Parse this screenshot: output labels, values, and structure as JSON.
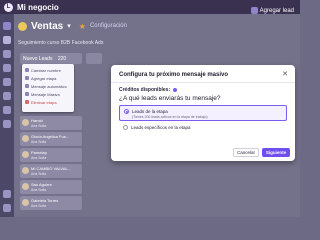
{
  "app": {
    "title": "Mi negocio"
  },
  "header": {
    "board_title": "Ventas",
    "config_label": "Configuración",
    "add_lead_label": "Agregar lead",
    "subtitle": "Seguimiento curso B2B Facebook Ads"
  },
  "columns": [
    {
      "title": "Nuevo Leads",
      "count": "220"
    }
  ],
  "context_menu": {
    "items": [
      {
        "label": "Cambiar nombre"
      },
      {
        "label": "Agregar etapa"
      },
      {
        "label": "Mensaje automático"
      },
      {
        "label": "Mensaje Masivo"
      },
      {
        "label": "Eliminar etapa"
      }
    ]
  },
  "lead_cards": [
    {
      "name": "Harold",
      "sub": "Ana Sofia"
    },
    {
      "name": "Gloria Angélica Fue...",
      "sub": "Ana Sofia"
    },
    {
      "name": "Pamelap",
      "sub": "Ana Sofia"
    },
    {
      "name": "MI CAMBIO VALVAL...",
      "sub": "Ana Sofia"
    },
    {
      "name": "Sao Aguirre",
      "sub": "Ana Sofia"
    },
    {
      "name": "Gabriela Torres",
      "sub": "Ana Sofia"
    }
  ],
  "modal": {
    "title": "Configura tu próximo mensaje masivo",
    "credits_label": "Créditos disponibles:",
    "question": "¿A qué leads enviarás tu mensaje?",
    "option_stage_label": "Leads de la etapa",
    "option_stage_note": "(Tienes 200 leads activos en la etapa de trabajo)",
    "option_specific_label": "Leads específicos en la etapa",
    "cancel_label": "Cancelar",
    "next_label": "Siguiente"
  },
  "colors": {
    "accent": "#6f4ef0",
    "topbar": "#3a3150"
  }
}
